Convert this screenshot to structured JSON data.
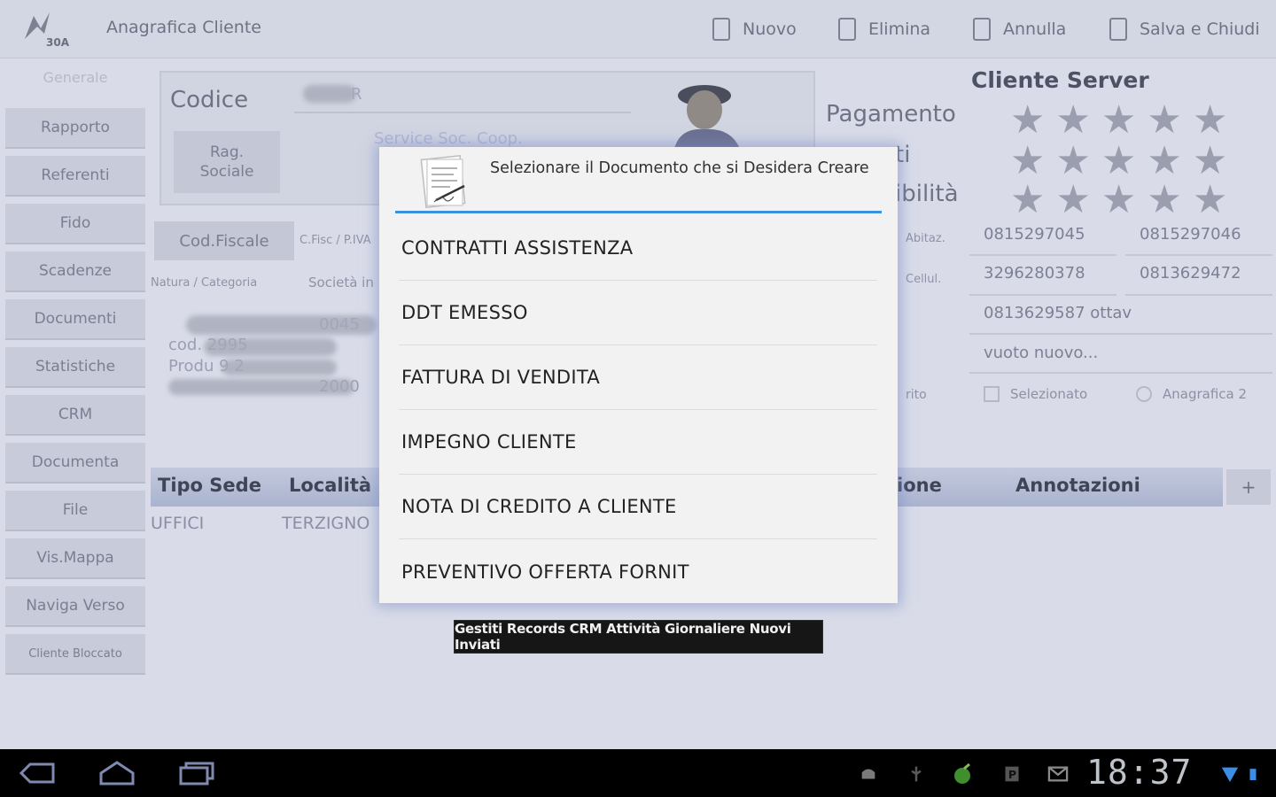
{
  "topbar": {
    "logo_text": "30A",
    "title": "Anagrafica Cliente",
    "buttons": [
      "Nuovo",
      "Elimina",
      "Annulla",
      "Salva e Chiudi"
    ]
  },
  "sidebar": {
    "header": "Generale",
    "items": [
      "Rapporto",
      "Referenti",
      "Fido",
      "Scadenze",
      "Documenti",
      "Statistiche",
      "CRM",
      "Documenta",
      "File",
      "Vis.Mappa",
      "Naviga Verso",
      "Cliente Bloccato"
    ]
  },
  "main": {
    "codice_label": "Codice",
    "codice_value": "R",
    "rag_sociale_value": "Service Soc. Coop.",
    "rag_sociale_button": "Rag.\nSociale",
    "cod_fiscale_button": "Cod.Fiscale",
    "cfisc_label": "C.Fisc / P.IVA",
    "natura_label": "Natura / Categoria",
    "societa_label": "Società in",
    "notes": [
      "0045",
      "cod. 2995",
      "Produ 9  2",
      "2000"
    ]
  },
  "right": {
    "title": "Cliente Server",
    "labels": [
      "Pagamento",
      "ti",
      "ibilità"
    ],
    "small_labels": [
      "Abitaz.",
      "Cellul.",
      "rito"
    ],
    "phones": [
      "0815297045",
      "0815297046",
      "3296280378",
      "0813629472",
      "0813629587 ottav",
      "vuoto nuovo..."
    ],
    "checkboxes": [
      "Selezionato",
      "Anagrafica 2"
    ]
  },
  "grid": {
    "headers": [
      "Tipo Sede",
      "Località",
      "ione",
      "Annotazioni"
    ],
    "plus": "+",
    "row": [
      "UFFICI",
      "TERZIGNO"
    ]
  },
  "dialog": {
    "title": "Selezionare il Documento che si Desidera Creare",
    "items": [
      "CONTRATTI ASSISTENZA",
      "DDT EMESSO",
      "FATTURA DI VENDITA",
      "IMPEGNO CLIENTE",
      "NOTA DI CREDITO A CLIENTE",
      "PREVENTIVO OFFERTA FORNIT"
    ]
  },
  "toast": "Gestiti Records CRM Attività Giornaliere Nuovi Inviati",
  "systembar": {
    "clock": "18:37",
    "status_icons": [
      "android-icon",
      "usb-icon",
      "app-icon",
      "p-icon",
      "mail-icon",
      "wifi-icon",
      "battery-icon"
    ]
  },
  "colors": {
    "accent": "#3d8fe0",
    "toast_bg": "#161616",
    "systembar_bg": "#000000"
  }
}
